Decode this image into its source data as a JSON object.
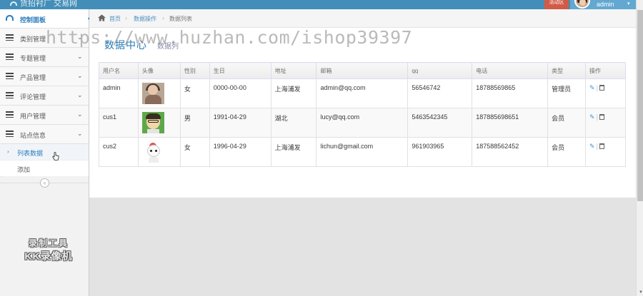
{
  "navbar": {
    "brand": "货招衬厂 交易网",
    "red_button_label": "活动区",
    "username": "admin",
    "caret": "▾"
  },
  "sidebar": {
    "items": [
      {
        "label": "控制面板",
        "icon": "dashboard-icon",
        "active": true
      },
      {
        "label": "类别管理",
        "icon": "list-icon",
        "chevron": "⌄"
      },
      {
        "label": "专题管理",
        "icon": "list-icon",
        "chevron": "⌄"
      },
      {
        "label": "产品管理",
        "icon": "list-icon",
        "chevron": "⌄"
      },
      {
        "label": "评论管理",
        "icon": "list-icon",
        "chevron": "⌄"
      },
      {
        "label": "用户管理",
        "icon": "list-icon",
        "chevron": "⌄"
      },
      {
        "label": "站点信息",
        "icon": "list-icon",
        "chevron": "⌄"
      }
    ],
    "sub_items": [
      {
        "label": "列表数据",
        "active": true
      },
      {
        "label": "添加"
      }
    ],
    "collapse_glyph": "«"
  },
  "breadcrumbs": {
    "home": "首页",
    "section": "数据操作",
    "current": "数据列表",
    "sep": "›"
  },
  "page": {
    "title": "数据中心",
    "subtitle": "数据列"
  },
  "table": {
    "headers": [
      "用户名",
      "头像",
      "性别",
      "生日",
      "地址",
      "邮箱",
      "qq",
      "电话",
      "类型",
      "操作"
    ],
    "rows": [
      {
        "username": "admin",
        "gender": "女",
        "birthday": "0000-00-00",
        "address": "上海浦发",
        "email": "admin@qq.com",
        "qq": "56546742",
        "phone": "18788569865",
        "type": "管理员"
      },
      {
        "username": "cus1",
        "gender": "男",
        "birthday": "1991-04-29",
        "address": "湖北",
        "email": "lucy@qq.com",
        "qq": "5463542345",
        "phone": "187885698651",
        "type": "会员"
      },
      {
        "username": "cus2",
        "gender": "女",
        "birthday": "1996-04-29",
        "address": "上海浦发",
        "email": "lichun@gmail.com",
        "qq": "961903965",
        "phone": "187588562452",
        "type": "会员"
      }
    ],
    "edit_glyph": "✎",
    "action_sep": "|"
  },
  "overlays": {
    "watermark": "https://www.huzhan.com/ishop39397",
    "recorder_line1": "录制工具",
    "recorder_line2": "KK录像机"
  },
  "colors": {
    "navbar": "#438eb9",
    "accent": "#2b7dbc",
    "danger": "#d15b47"
  }
}
